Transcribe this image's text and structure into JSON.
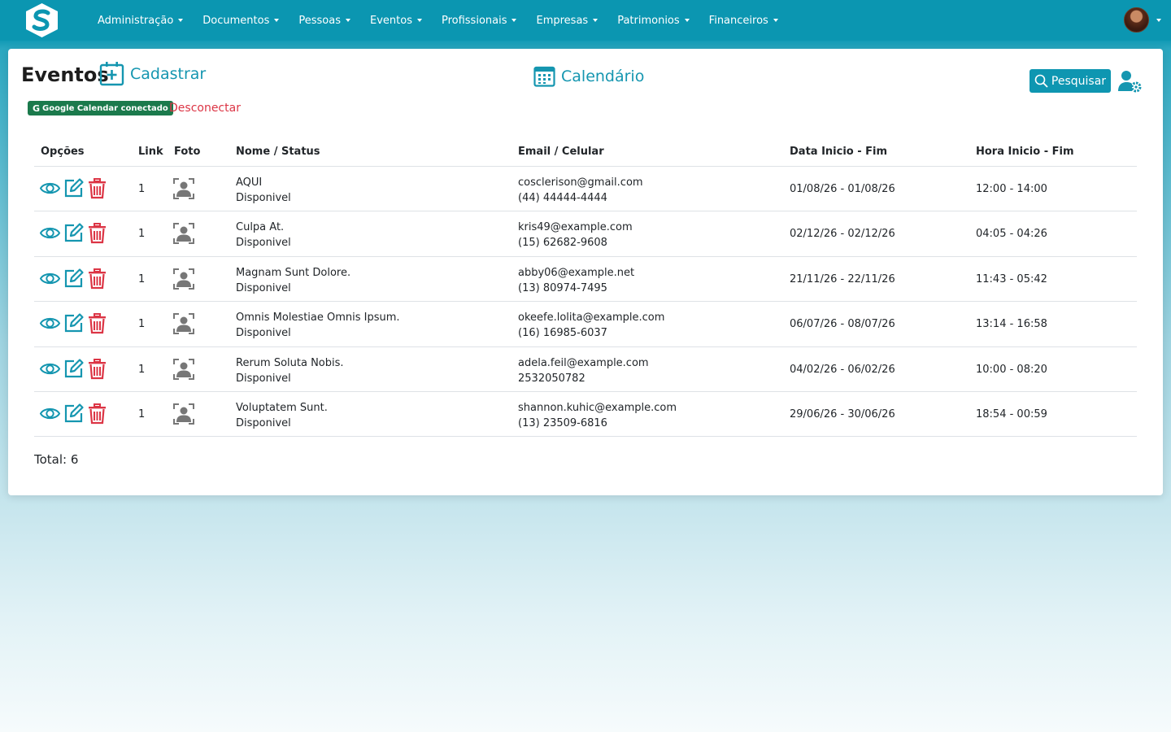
{
  "colors": {
    "navbar": "#0b96b1",
    "accent": "#1596b0",
    "danger": "#dc3545",
    "google_badge": "#1b7a4c"
  },
  "navbar": {
    "logo_icon": "app-logo-s",
    "items": [
      {
        "label": "Administração"
      },
      {
        "label": "Documentos"
      },
      {
        "label": "Pessoas"
      },
      {
        "label": "Eventos"
      },
      {
        "label": "Profissionais"
      },
      {
        "label": "Empresas"
      },
      {
        "label": "Patrimonios"
      },
      {
        "label": "Financeiros"
      }
    ],
    "user_icon": "user-avatar"
  },
  "header": {
    "title": "Eventos",
    "cadastrar_label": "Cadastrar",
    "calendario_label": "Calendário",
    "pesquisar_label": "Pesquisar",
    "google_badge_icon": "G",
    "google_badge_label": "Google Calendar conectado",
    "desconectar_label": "Desconectar"
  },
  "table": {
    "headers": {
      "opcoes": "Opções",
      "link": "Link",
      "foto": "Foto",
      "nome_status": "Nome / Status",
      "email_celular": "Email / Celular",
      "data": "Data Inicio - Fim",
      "hora": "Hora Inicio - Fim"
    },
    "rows": [
      {
        "link": "1",
        "nome": "AQUI",
        "status": "Disponivel",
        "email": "cosclerison@gmail.com",
        "celular": "(44) 44444-4444",
        "data": "01/08/26 - 01/08/26",
        "hora": "12:00 - 14:00"
      },
      {
        "link": "1",
        "nome": "Culpa At.",
        "status": "Disponivel",
        "email": "kris49@example.com",
        "celular": "(15) 62682-9608",
        "data": "02/12/26 - 02/12/26",
        "hora": "04:05 - 04:26"
      },
      {
        "link": "1",
        "nome": "Magnam Sunt Dolore.",
        "status": "Disponivel",
        "email": "abby06@example.net",
        "celular": "(13) 80974-7495",
        "data": "21/11/26 - 22/11/26",
        "hora": "11:43 - 05:42"
      },
      {
        "link": "1",
        "nome": "Omnis Molestiae Omnis Ipsum.",
        "status": "Disponivel",
        "email": "okeefe.lolita@example.com",
        "celular": "(16) 16985-6037",
        "data": "06/07/26 - 08/07/26",
        "hora": "13:14 - 16:58"
      },
      {
        "link": "1",
        "nome": "Rerum Soluta Nobis.",
        "status": "Disponivel",
        "email": "adela.feil@example.com",
        "celular": "2532050782",
        "data": "04/02/26 - 06/02/26",
        "hora": "10:00 - 08:20"
      },
      {
        "link": "1",
        "nome": "Voluptatem Sunt.",
        "status": "Disponivel",
        "email": "shannon.kuhic@example.com",
        "celular": "(13) 23509-6816",
        "data": "29/06/26 - 30/06/26",
        "hora": "18:54 - 00:59"
      }
    ]
  },
  "footer": {
    "total_label": "Total: 6"
  }
}
